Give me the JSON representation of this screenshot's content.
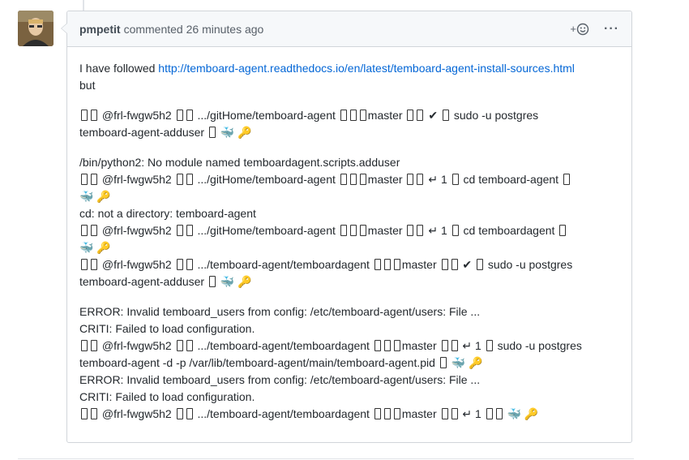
{
  "comment": {
    "author": "pmpetit",
    "action": "commented",
    "timestamp": "26 minutes ago",
    "reaction_icon": "smiley-add-icon",
    "menu_icon": "kebab-horizontal-icon",
    "intro_prefix": "I have followed",
    "intro_link": "http://temboard-agent.readthedocs.io/en/latest/temboard-agent-install-sources.html",
    "intro_suffix": "but",
    "line1": "@frl-fwgw5h2",
    "line1b": ".../gitHome/temboard-agent",
    "branch": "master",
    "check": "✔",
    "return": "↵ 1",
    "cmd1": "sudo -u postgres",
    "cmd1b": "temboard-agent-adduser",
    "err1": "/bin/python2: No module named temboardagent.scripts.adduser",
    "cmd2": "cd temboard-agent",
    "err2": "cd: not a directory: temboard-agent",
    "cmd3": "cd temboardagent",
    "path2": ".../temboard-agent/temboardagent",
    "err3": "ERROR: Invalid temboard_users from config: /etc/temboard-agent/users: File ...",
    "err4": "CRITI: Failed to load configuration.",
    "cmd5b": "temboard-agent -d -p /var/lib/temboard-agent/main/temboard-agent.pid"
  }
}
